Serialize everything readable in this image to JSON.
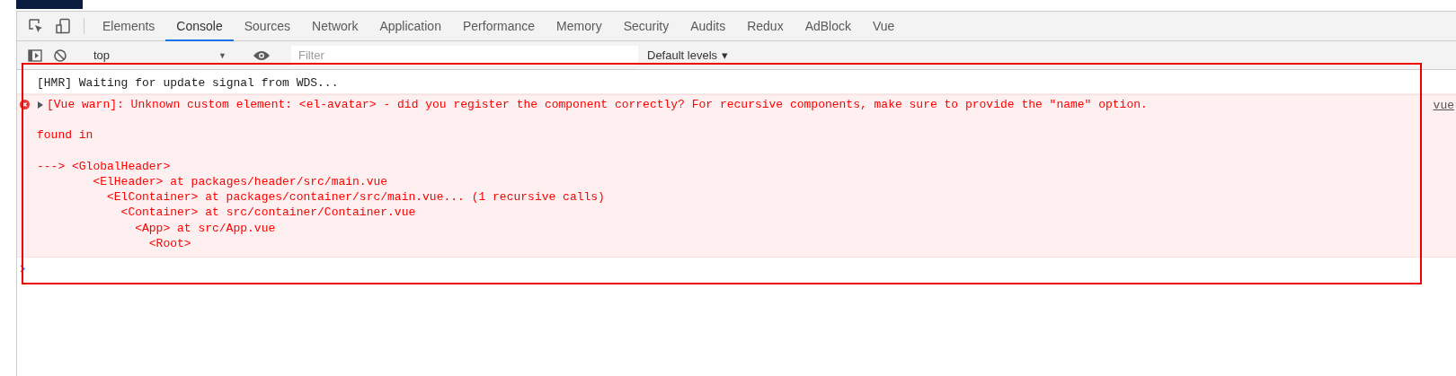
{
  "tabs": [
    {
      "label": "Elements",
      "selected": false
    },
    {
      "label": "Console",
      "selected": true
    },
    {
      "label": "Sources",
      "selected": false
    },
    {
      "label": "Network",
      "selected": false
    },
    {
      "label": "Application",
      "selected": false
    },
    {
      "label": "Performance",
      "selected": false
    },
    {
      "label": "Memory",
      "selected": false
    },
    {
      "label": "Security",
      "selected": false
    },
    {
      "label": "Audits",
      "selected": false
    },
    {
      "label": "Redux",
      "selected": false
    },
    {
      "label": "AdBlock",
      "selected": false
    },
    {
      "label": "Vue",
      "selected": false
    }
  ],
  "toolbar": {
    "context": "top",
    "context_caret": "▼",
    "filter": {
      "placeholder": "Filter"
    },
    "levels": "Default levels",
    "levels_caret": "▾"
  },
  "console": {
    "messages": [
      {
        "kind": "log",
        "text": "[HMR] Waiting for update signal from WDS..."
      },
      {
        "kind": "error",
        "text": "[Vue warn]: Unknown custom element: <el-avatar> - did you register the component correctly? For recursive components, make sure to provide the \"name\" option.",
        "source": "vue",
        "expanded": false,
        "found_in": "found in",
        "trace_root": "---> <GlobalHeader>",
        "trace": [
          {
            "text": "<ElHeader> at packages/header/src/main.vue",
            "children": [
              {
                "text": "<ElContainer> at packages/container/src/main.vue... (1 recursive calls)",
                "children": [
                  {
                    "text": "<Container> at src/container/Container.vue",
                    "children": [
                      {
                        "text": "<App> at src/App.vue",
                        "children": [
                          {
                            "text": "<Root>"
                          }
                        ]
                      }
                    ]
                  }
                ]
              }
            ]
          }
        ]
      }
    ]
  }
}
